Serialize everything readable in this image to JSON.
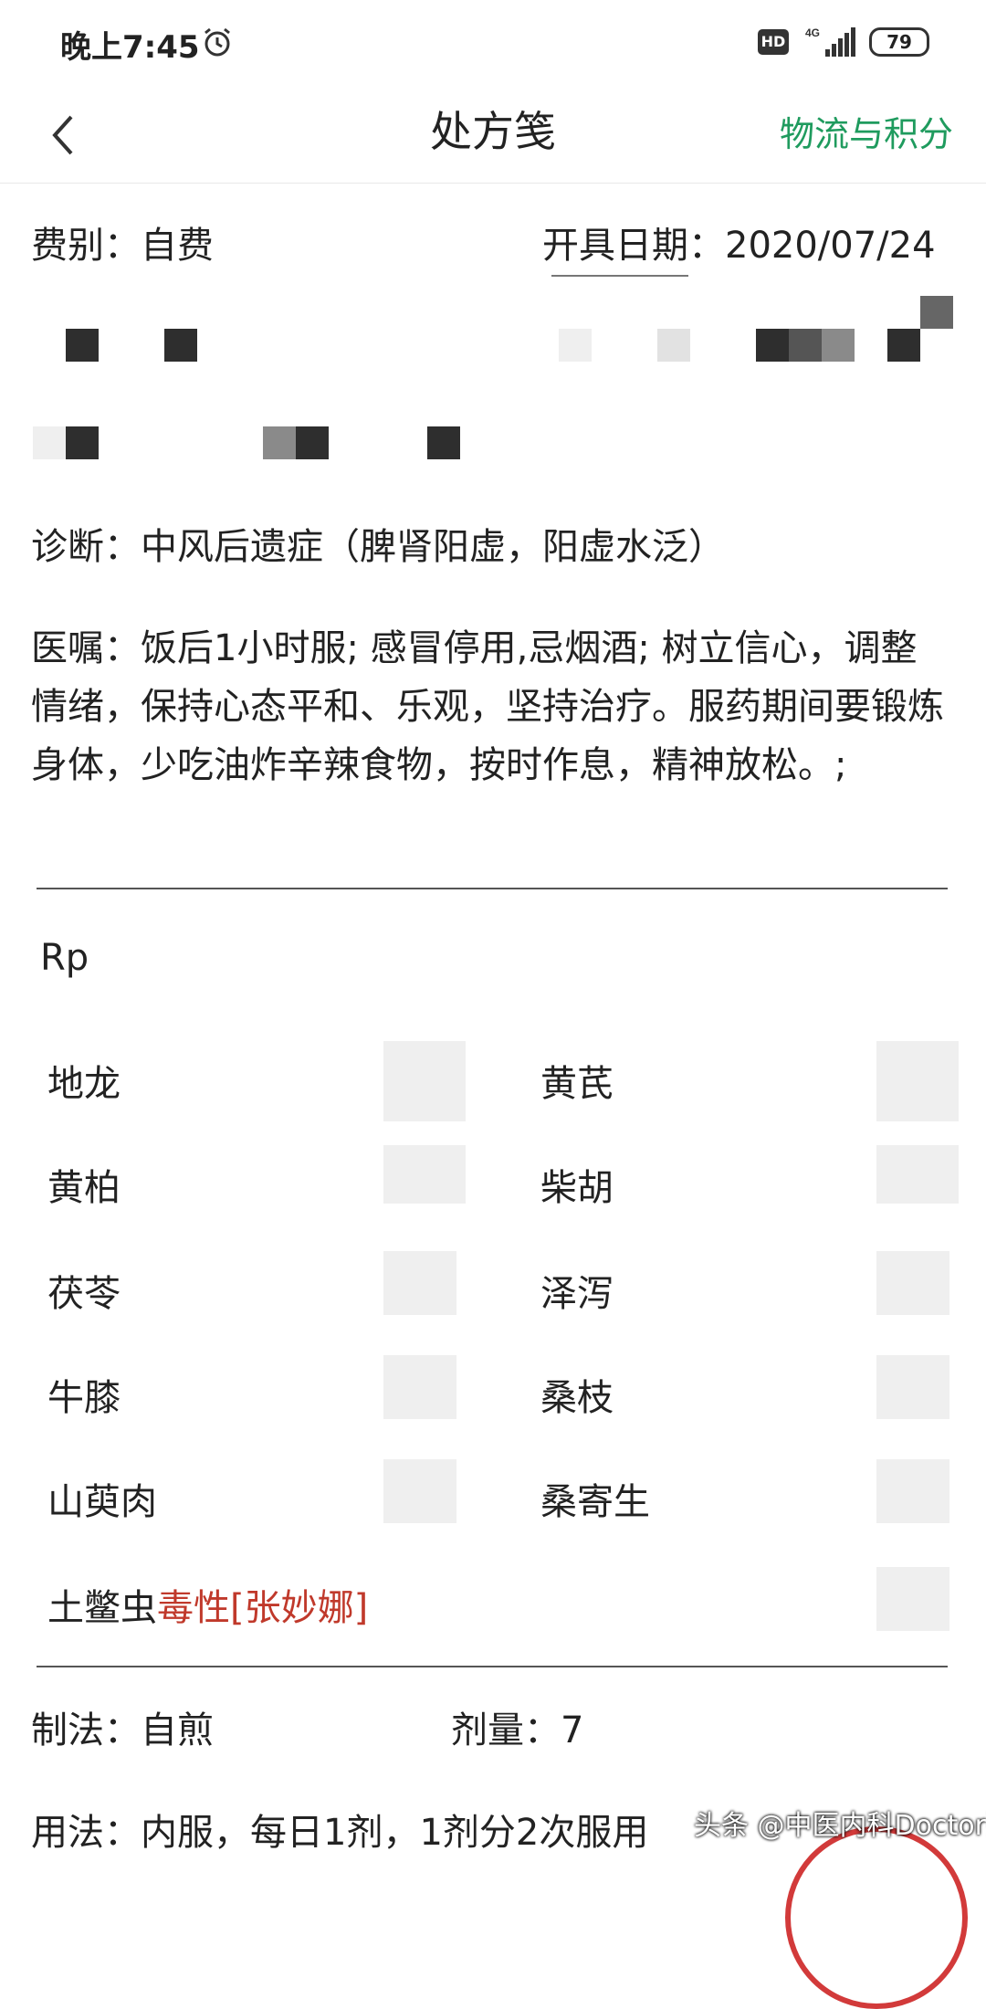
{
  "status_bar": {
    "time": "晚上7:45",
    "hd": "HD",
    "network": "4G",
    "battery": "79"
  },
  "nav": {
    "title": "处方笺",
    "link": "物流与积分"
  },
  "fields": {
    "fee_label": "费别：",
    "fee_value": "自费",
    "date_label": "开具日期：",
    "date_value": "2020/07/24"
  },
  "diagnosis": {
    "label": "诊断：",
    "value": "中风后遗症（脾肾阳虚，阳虚水泛）"
  },
  "advice": {
    "label": "医嘱：",
    "value": "饭后1小时服; 感冒停用,忌烟酒; 树立信心，调整情绪，保持心态平和、乐观，坚持治疗。服药期间要锻炼身体，少吃油炸辛辣食物，按时作息，精神放松。;"
  },
  "rp": {
    "label": "Rp"
  },
  "herbs": [
    {
      "name": "地龙"
    },
    {
      "name": "黄芪"
    },
    {
      "name": "黄柏"
    },
    {
      "name": "柴胡"
    },
    {
      "name": "茯苓"
    },
    {
      "name": "泽泻"
    },
    {
      "name": "牛膝"
    },
    {
      "name": "桑枝"
    },
    {
      "name": "山萸肉"
    },
    {
      "name": "桑寄生"
    }
  ],
  "toxic_herb": {
    "name": "土鳖虫",
    "note": "毒性[张妙娜]"
  },
  "method": {
    "label": "制法：",
    "value": "自煎"
  },
  "dose": {
    "label": "剂量：",
    "value": "7"
  },
  "usage": {
    "label": "用法：",
    "value": "内服，每日1剂，1剂分2次服用"
  },
  "watermark": "头条 @中医内科Doctor张"
}
